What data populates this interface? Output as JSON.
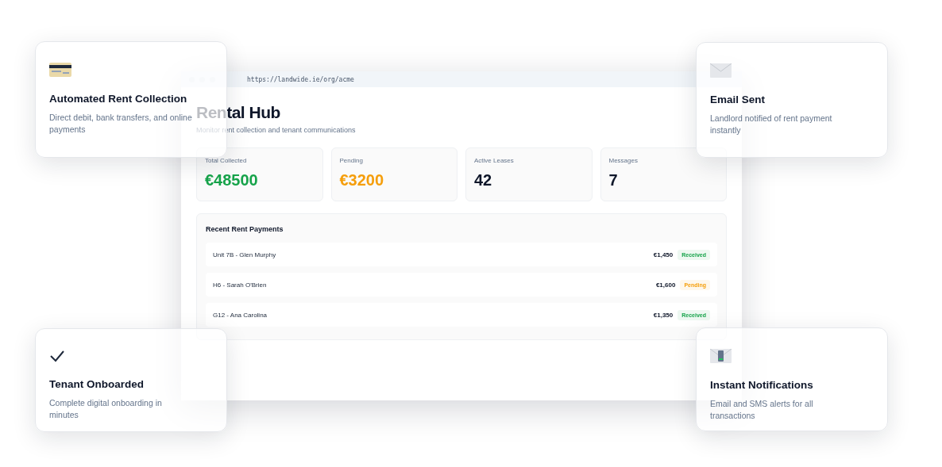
{
  "browser": {
    "url": "https://landwide.ie/org/acme"
  },
  "header": {
    "title": "Rental Hub",
    "subtitle": "Monitor rent collection and tenant communications"
  },
  "stats": [
    {
      "label": "Total Collected",
      "value": "€48500",
      "color": "#16a34a"
    },
    {
      "label": "Pending",
      "value": "€3200",
      "color": "#f59e0b"
    },
    {
      "label": "Active Leases",
      "value": "42",
      "color": "#0f172a"
    },
    {
      "label": "Messages",
      "value": "7",
      "color": "#0f172a"
    }
  ],
  "payments": {
    "title": "Recent Rent Payments",
    "rows": [
      {
        "tenant": "Unit 7B - Glen Murphy",
        "amount": "€1,450",
        "status": "Received",
        "color": "#16a34a"
      },
      {
        "tenant": "H6 - Sarah O'Brien",
        "amount": "€1,600",
        "status": "Pending",
        "color": "#f59e0b"
      },
      {
        "tenant": "G12 - Ana Carolina",
        "amount": "€1,350",
        "status": "Received",
        "color": "#16a34a"
      }
    ]
  },
  "feature_cards": [
    {
      "kind": "card",
      "title": "Automated Rent Collection",
      "text": "Direct debit, bank transfers, and online payments"
    },
    {
      "kind": "envelope",
      "title": "Email Sent",
      "text": "Landlord notified of rent payment instantly"
    },
    {
      "kind": "check",
      "title": "Tenant Onboarded",
      "text": "Complete digital onboarding in minutes"
    },
    {
      "kind": "phone",
      "title": "Instant Notifications",
      "text": "Email and SMS alerts for all transactions"
    }
  ]
}
